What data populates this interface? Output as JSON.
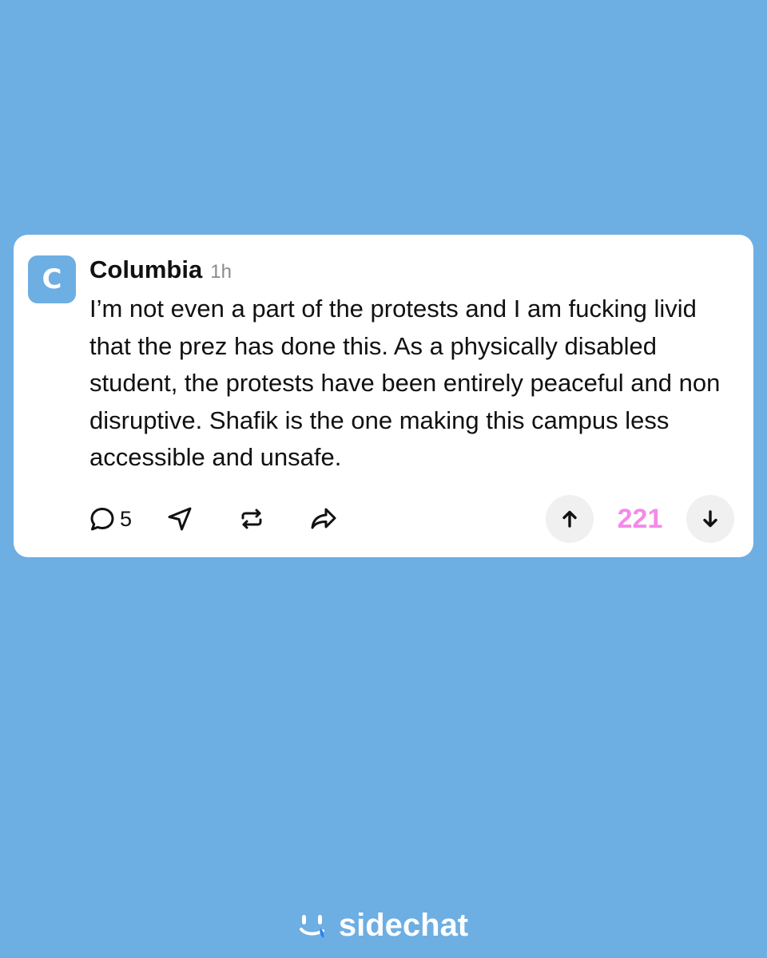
{
  "post": {
    "avatar_letter": "C",
    "author": "Columbia",
    "time": "1h",
    "text": "I’m not even a part of the protests and I am fucking livid that the prez has done this. As a physically disabled student, the protests have been entirely peaceful and non disruptive. Shafik is the one making this campus less accessible and unsafe.",
    "comment_count": "5",
    "vote_score": "221"
  },
  "icons": {
    "comment": "comment-bubble-icon",
    "send": "send-arrow-icon",
    "repost": "repost-icon",
    "share": "share-forward-icon",
    "upvote": "arrow-up-icon",
    "downvote": "arrow-down-icon"
  },
  "brand": {
    "name": "sidechat"
  },
  "colors": {
    "background": "#6daee3",
    "card": "#ffffff",
    "score": "#f48ae9",
    "vote_button_bg": "#f0f0f0"
  }
}
